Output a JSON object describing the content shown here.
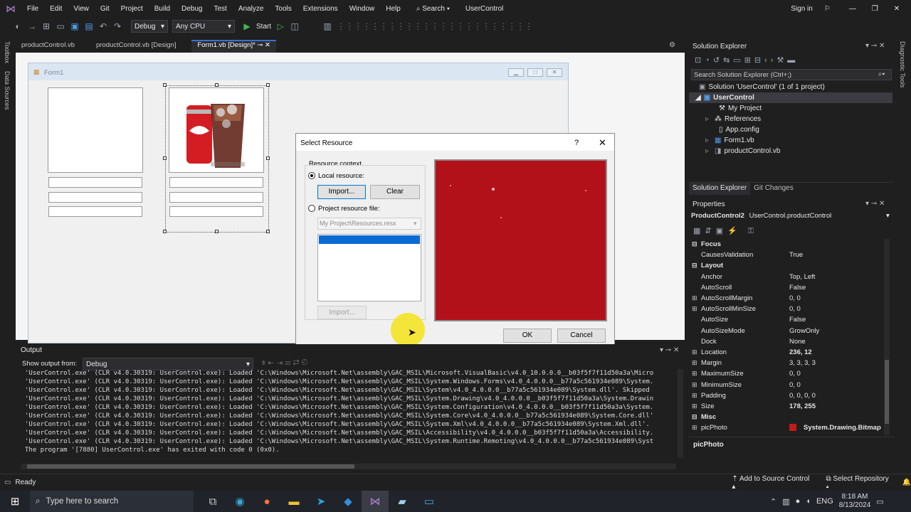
{
  "menu": {
    "items": [
      "File",
      "Edit",
      "View",
      "Git",
      "Project",
      "Build",
      "Debug",
      "Test",
      "Analyze",
      "Tools",
      "Extensions",
      "Window",
      "Help"
    ],
    "search": "Search",
    "solution_name": "UserControl",
    "sign_in": "Sign in"
  },
  "toolbar": {
    "config": "Debug",
    "platform": "Any CPU",
    "start": "Start"
  },
  "side_tabs": {
    "toolbox": "Toolbox",
    "data_sources": "Data Sources",
    "diagnostic": "Diagnostic Tools"
  },
  "doc_tabs": [
    "productControl.vb",
    "productControl.vb [Design]",
    "Form1.vb [Design]*"
  ],
  "form1": {
    "title": "Form1"
  },
  "dialog": {
    "title": "Select Resource",
    "help": "?",
    "resource_context": "Resource context",
    "local_resource": "Local resource:",
    "import": "Import...",
    "clear": "Clear",
    "project_resource_file": "Project resource file:",
    "resx_value": "My Project\\Resources.resx",
    "import2": "Import...",
    "ok": "OK",
    "cancel": "Cancel",
    "preview_color": "#b3111a"
  },
  "output": {
    "title": "Output",
    "show_from_label": "Show output from:",
    "show_from_value": "Debug",
    "lines": [
      "'UserControl.exe' (CLR v4.0.30319: UserControl.exe): Loaded 'C:\\Windows\\Microsoft.Net\\assembly\\GAC_MSIL\\Microsoft.VisualBasic\\v4.0_10.0.0.0__b03f5f7f11d50a3a\\Micro",
      "'UserControl.exe' (CLR v4.0.30319: UserControl.exe): Loaded 'C:\\Windows\\Microsoft.Net\\assembly\\GAC_MSIL\\System.Windows.Forms\\v4.0_4.0.0.0__b77a5c561934e089\\System.",
      "'UserControl.exe' (CLR v4.0.30319: UserControl.exe): Loaded 'C:\\Windows\\Microsoft.Net\\assembly\\GAC_MSIL\\System\\v4.0_4.0.0.0__b77a5c561934e089\\System.dll'. Skipped",
      "'UserControl.exe' (CLR v4.0.30319: UserControl.exe): Loaded 'C:\\Windows\\Microsoft.Net\\assembly\\GAC_MSIL\\System.Drawing\\v4.0_4.0.0.0__b03f5f7f11d50a3a\\System.Drawin",
      "'UserControl.exe' (CLR v4.0.30319: UserControl.exe): Loaded 'C:\\Windows\\Microsoft.Net\\assembly\\GAC_MSIL\\System.Configuration\\v4.0_4.0.0.0__b03f5f7f11d50a3a\\System.",
      "'UserControl.exe' (CLR v4.0.30319: UserControl.exe): Loaded 'C:\\Windows\\Microsoft.Net\\assembly\\GAC_MSIL\\System.Core\\v4.0_4.0.0.0__b77a5c561934e089\\System.Core.dll'",
      "'UserControl.exe' (CLR v4.0.30319: UserControl.exe): Loaded 'C:\\Windows\\Microsoft.Net\\assembly\\GAC_MSIL\\System.Xml\\v4.0_4.0.0.0__b77a5c561934e089\\System.Xml.dll'.",
      "'UserControl.exe' (CLR v4.0.30319: UserControl.exe): Loaded 'C:\\Windows\\Microsoft.Net\\assembly\\GAC_MSIL\\Accessibility\\v4.0_4.0.0.0__b03f5f7f11d50a3a\\Accessibility.",
      "'UserControl.exe' (CLR v4.0.30319: UserControl.exe): Loaded 'C:\\Windows\\Microsoft.Net\\assembly\\GAC_MSIL\\System.Runtime.Remoting\\v4.0_4.0.0.0__b77a5c561934e089\\Syst",
      "The program '[7880] UserControl.exe' has exited with code 0 (0x0)."
    ]
  },
  "solution_explorer": {
    "title": "Solution Explorer",
    "search_placeholder": "Search Solution Explorer (Ctrl+;)",
    "solution": "Solution 'UserControl' (1 of 1 project)",
    "project": "UserControl",
    "items": [
      "My Project",
      "References",
      "App.config",
      "Form1.vb",
      "productControl.vb"
    ],
    "tabs": [
      "Solution Explorer",
      "Git Changes"
    ]
  },
  "properties": {
    "title": "Properties",
    "object_name": "ProductControl2",
    "object_type": "UserControl.productControl",
    "rows": [
      {
        "cat": true,
        "name": "Focus"
      },
      {
        "name": "CausesValidation",
        "value": "True"
      },
      {
        "cat": true,
        "name": "Layout"
      },
      {
        "name": "Anchor",
        "value": "Top, Left"
      },
      {
        "name": "AutoScroll",
        "value": "False"
      },
      {
        "name": "AutoScrollMargin",
        "value": "0, 0",
        "exp": true
      },
      {
        "name": "AutoScrollMinSize",
        "value": "0, 0",
        "exp": true
      },
      {
        "name": "AutoSize",
        "value": "False"
      },
      {
        "name": "AutoSizeMode",
        "value": "GrowOnly"
      },
      {
        "name": "Dock",
        "value": "None"
      },
      {
        "name": "Location",
        "value": "236, 12",
        "exp": true,
        "bold": true
      },
      {
        "name": "Margin",
        "value": "3, 3, 3, 3",
        "exp": true
      },
      {
        "name": "MaximumSize",
        "value": "0, 0",
        "exp": true
      },
      {
        "name": "MinimumSize",
        "value": "0, 0",
        "exp": true
      },
      {
        "name": "Padding",
        "value": "0, 0, 0, 0",
        "exp": true
      },
      {
        "name": "Size",
        "value": "178, 255",
        "exp": true,
        "bold": true
      },
      {
        "cat": true,
        "name": "Misc"
      },
      {
        "name": "picPhoto",
        "value": "System.Drawing.Bitmap",
        "exp": true,
        "bold": true
      }
    ],
    "description_title": "picPhoto"
  },
  "status": {
    "ready": "Ready",
    "add_source_control": "Add to Source Control",
    "select_repository": "Select Repository"
  },
  "taskbar": {
    "search_placeholder": "Type here to search",
    "language": "ENG",
    "time": "8:18 AM",
    "date": "8/13/2024"
  }
}
